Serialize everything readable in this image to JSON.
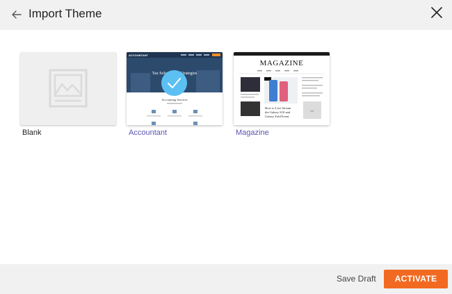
{
  "header": {
    "title": "Import Theme",
    "back_icon": "arrow-left-icon",
    "close_icon": "close-icon"
  },
  "themes": [
    {
      "label": "Blank",
      "selected": false
    },
    {
      "label": "Accountant",
      "selected": true,
      "preview": {
        "brand": "ACCOUNTANT",
        "hero_text": "Tax Solutions & Strategies",
        "section_title": "Accounting Services"
      }
    },
    {
      "label": "Magazine",
      "selected": false,
      "preview": {
        "masthead": "MAGAZINE",
        "headline_line1": "How to Live Stream",
        "headline_line2": "the Galaxy S10 and",
        "headline_line3": "Galaxy Fold Event",
        "ad_text": "AD"
      }
    }
  ],
  "footer": {
    "save_draft": "Save Draft",
    "activate": "ACTIVATE"
  },
  "colors": {
    "accent": "#f26a21",
    "link": "#5a54b4",
    "check": "#5cc0f3",
    "accountant_hero": "#2c4a6c"
  }
}
